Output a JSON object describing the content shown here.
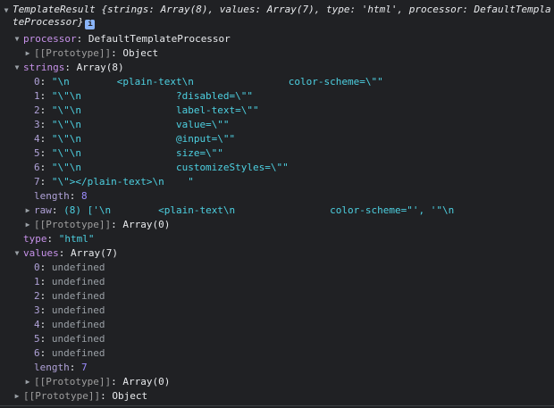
{
  "header": {
    "text": "TemplateResult {strings: Array(8), values: Array(7), type: 'html', processor: DefaultTemplateProcessor}",
    "info": "i"
  },
  "processor": {
    "key": "processor",
    "value": "DefaultTemplateProcessor",
    "proto_key": "[[Prototype]]",
    "proto_value": "Object"
  },
  "strings": {
    "key": "strings",
    "value": "Array(8)",
    "items": [
      {
        "index": "0",
        "value": "\"\\n        <plain-text\\n                color-scheme=\\\"\""
      },
      {
        "index": "1",
        "value": "\"\\\"\\n                ?disabled=\\\"\""
      },
      {
        "index": "2",
        "value": "\"\\\"\\n                label-text=\\\"\""
      },
      {
        "index": "3",
        "value": "\"\\\"\\n                value=\\\"\""
      },
      {
        "index": "4",
        "value": "\"\\\"\\n                @input=\\\"\""
      },
      {
        "index": "5",
        "value": "\"\\\"\\n                size=\\\"\""
      },
      {
        "index": "6",
        "value": "\"\\\"\\n                customizeStyles=\\\"\""
      },
      {
        "index": "7",
        "value": "\"\\\"></plain-text>\\n    \""
      }
    ],
    "length_key": "length",
    "length_value": "8",
    "raw_key": "raw",
    "raw_value": "(8) ['\\n        <plain-text\\n                color-scheme=\"', '\"\\n",
    "proto_key": "[[Prototype]]",
    "proto_value": "Array(0)"
  },
  "type": {
    "key": "type",
    "value": "\"html\""
  },
  "values": {
    "key": "values",
    "value": "Array(7)",
    "items": [
      {
        "index": "0",
        "value": "undefined"
      },
      {
        "index": "1",
        "value": "undefined"
      },
      {
        "index": "2",
        "value": "undefined"
      },
      {
        "index": "3",
        "value": "undefined"
      },
      {
        "index": "4",
        "value": "undefined"
      },
      {
        "index": "5",
        "value": "undefined"
      },
      {
        "index": "6",
        "value": "undefined"
      }
    ],
    "length_key": "length",
    "length_value": "7",
    "proto_key": "[[Prototype]]",
    "proto_value": "Array(0)"
  },
  "root_proto": {
    "key": "[[Prototype]]",
    "value": "Object"
  },
  "icons": {
    "expanded": "▼",
    "collapsed": "▶"
  },
  "colors": {
    "background": "#202124",
    "string": "#4dd0e1",
    "number": "#9c8cff",
    "key": "#c792ea"
  }
}
